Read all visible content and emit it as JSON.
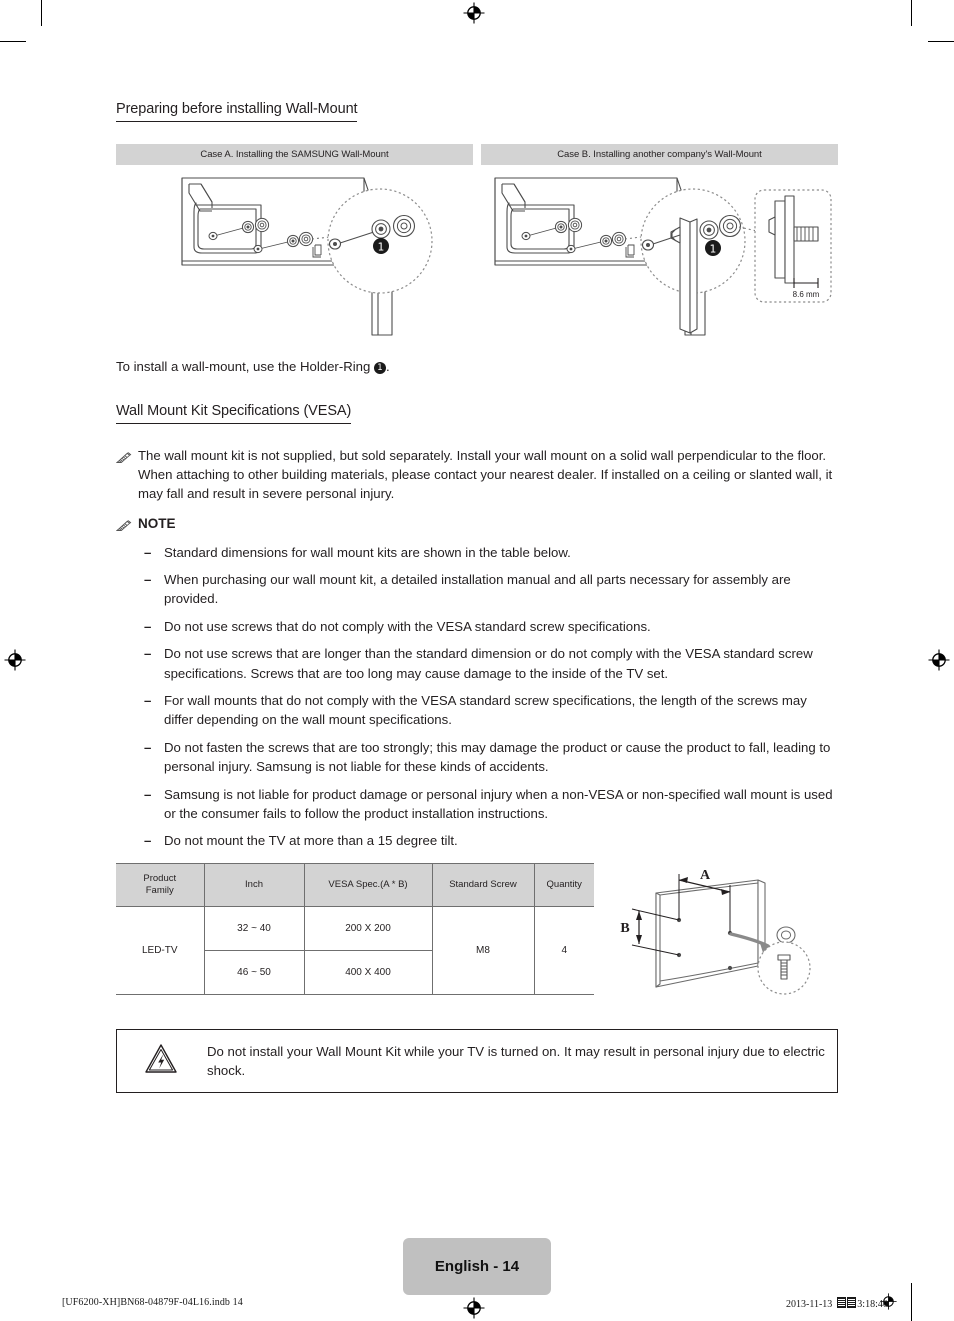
{
  "page": {
    "section_title": "Preparing before installing Wall-Mount",
    "holder_ring_sentence_prefix": "To install a wall-mount, use the Holder-Ring ",
    "holder_ring_marker": "1",
    "holder_ring_sentence_suffix": ".",
    "vesa_title": "Wall Mount Kit Specifications (VESA)"
  },
  "cases": [
    {
      "id": "case-a",
      "title": "Case A. Installing the SAMSUNG Wall-Mount",
      "callout_marker": "1"
    },
    {
      "id": "case-b",
      "title": "Case B. Installing another company's Wall-Mount",
      "callout_marker": "1",
      "detail_dimension": "8.6 mm"
    }
  ],
  "intro_note": "The wall mount kit is not supplied, but sold separately. Install your wall mount on a solid wall perpendicular to the floor. When attaching to other building materials, please contact your nearest dealer. If installed on a ceiling or slanted wall, it may fall and result in severe personal injury.",
  "note_label": "NOTE",
  "notes": [
    "Standard dimensions for wall mount kits are shown in the table below.",
    "When purchasing our wall mount kit, a detailed installation manual and all parts necessary for assembly are provided.",
    "Do not use screws that do not comply with the VESA standard screw specifications.",
    "Do not use screws that are longer than the standard dimension or do not comply with the VESA standard screw specifications. Screws that are too long may cause damage to the inside of the TV set.",
    "For wall mounts that do not comply with the VESA standard screw specifications, the length of the screws may differ depending on the wall mount specifications.",
    "Do not fasten the screws that are too strongly; this may damage the product or cause the product to fall, leading to personal injury. Samsung is not liable for these kinds of accidents.",
    "Samsung is not liable for product damage or personal injury when a non-VESA or non-specified wall mount is used or the consumer fails to follow the product installation instructions.",
    "Do not mount the TV at more than a 15 degree tilt."
  ],
  "spec_table": {
    "headers": [
      "Product\nFamily",
      "Inch",
      "VESA Spec.(A * B)",
      "Standard Screw",
      "Quantity"
    ],
    "header_product_family_line1": "Product",
    "header_product_family_line2": "Family",
    "header_inch": "Inch",
    "header_vesa": "VESA Spec.(A * B)",
    "header_screw": "Standard Screw",
    "header_quantity": "Quantity",
    "product_family": "LED-TV",
    "standard_screw": "M8",
    "quantity": "4",
    "rows": [
      {
        "inch": "32 ~ 40",
        "vesa": "200 X 200"
      },
      {
        "inch": "46 ~ 50",
        "vesa": "400 X 400"
      }
    ]
  },
  "tv_diagram": {
    "label_a": "A",
    "label_b": "B"
  },
  "caution": {
    "text": "Do not install your Wall Mount Kit while your TV is turned on. It may result in personal injury due to electric shock."
  },
  "footer": {
    "page_badge": "English - 14",
    "file_ref": "[UF6200-XH]BN68-04879F-04L16.indb   14",
    "date": "2013-11-13",
    "time": "3:18:40"
  }
}
